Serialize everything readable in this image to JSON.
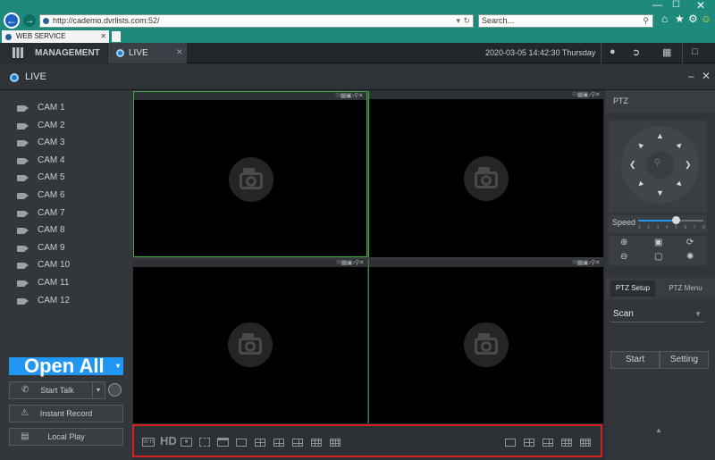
{
  "browser": {
    "url": "http://cademo.dvrlists.com:52/",
    "search_placeholder": "Search...",
    "tab_title": "WEB SERVICE"
  },
  "appbar": {
    "management_label": "MANAGEMENT",
    "live_tab_label": "LIVE",
    "datetime": "2020-03-05 14:42:30 Thursday"
  },
  "live_header": {
    "title": "LIVE"
  },
  "cameras": [
    "CAM 1",
    "CAM 2",
    "CAM 3",
    "CAM 4",
    "CAM 5",
    "CAM 6",
    "CAM 7",
    "CAM 8",
    "CAM 9",
    "CAM 10",
    "CAM 11",
    "CAM 12"
  ],
  "left_controls": {
    "open_all": "Open All",
    "start_talk": "Start Talk",
    "instant_record": "Instant Record",
    "local_play": "Local Play"
  },
  "toolbar": {
    "hd_label": "HD"
  },
  "ptz": {
    "title": "PTZ",
    "speed_label": "Speed",
    "speed_ticks": [
      "1",
      "2",
      "3",
      "4",
      "5",
      "6",
      "7",
      "8"
    ],
    "speed_value": 5,
    "setup_tab": "PTZ Setup",
    "menu_tab": "PTZ Menu",
    "mode_selected": "Scan",
    "start_button": "Start",
    "setting_button": "Setting"
  },
  "colors": {
    "browser_chrome": "#1e8a7c",
    "accent_blue": "#2196f3",
    "selected_pane_border": "#3fae3f",
    "highlight_box": "#d32222"
  }
}
